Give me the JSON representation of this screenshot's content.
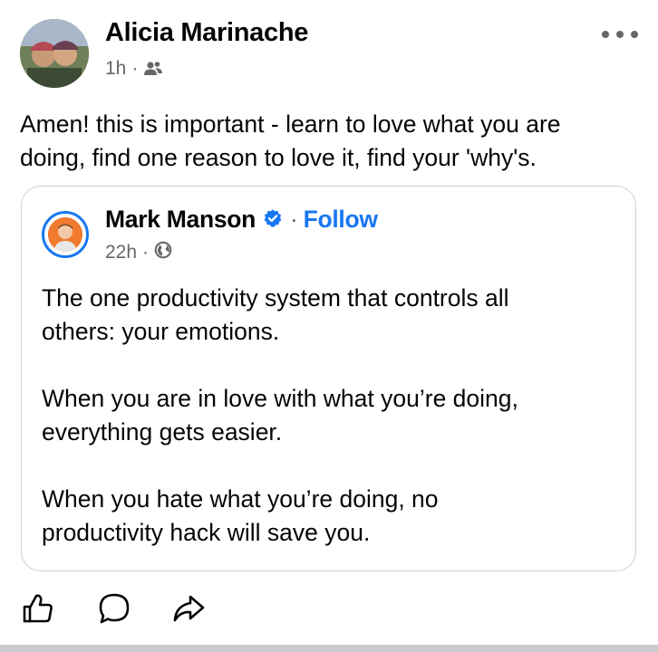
{
  "post": {
    "author": "Alicia Marinache",
    "time": "1h",
    "separator": "·",
    "audience_icon": "friends-icon",
    "more_icon": "more-options-icon",
    "text": "Amen! this is important - learn to love what you are\ndoing, find one reason to love it, find your 'why's."
  },
  "shared_post": {
    "author": "Mark Manson",
    "verified_icon": "verified-badge-icon",
    "separator": "·",
    "follow_label": "Follow",
    "time": "22h",
    "audience_icon": "globe-icon",
    "text": "The one productivity system that controls all\nothers: your emotions.\n\nWhen you are in love with what you’re doing,\neverything gets easier.\n\nWhen you hate what you’re doing, no\nproductivity hack will save you."
  },
  "actions": {
    "like_icon": "like-icon",
    "comment_icon": "comment-icon",
    "share_icon": "share-icon"
  },
  "colors": {
    "link_blue": "#1877f2",
    "secondary_text": "#65676b",
    "card_border": "#ccd0d5"
  }
}
